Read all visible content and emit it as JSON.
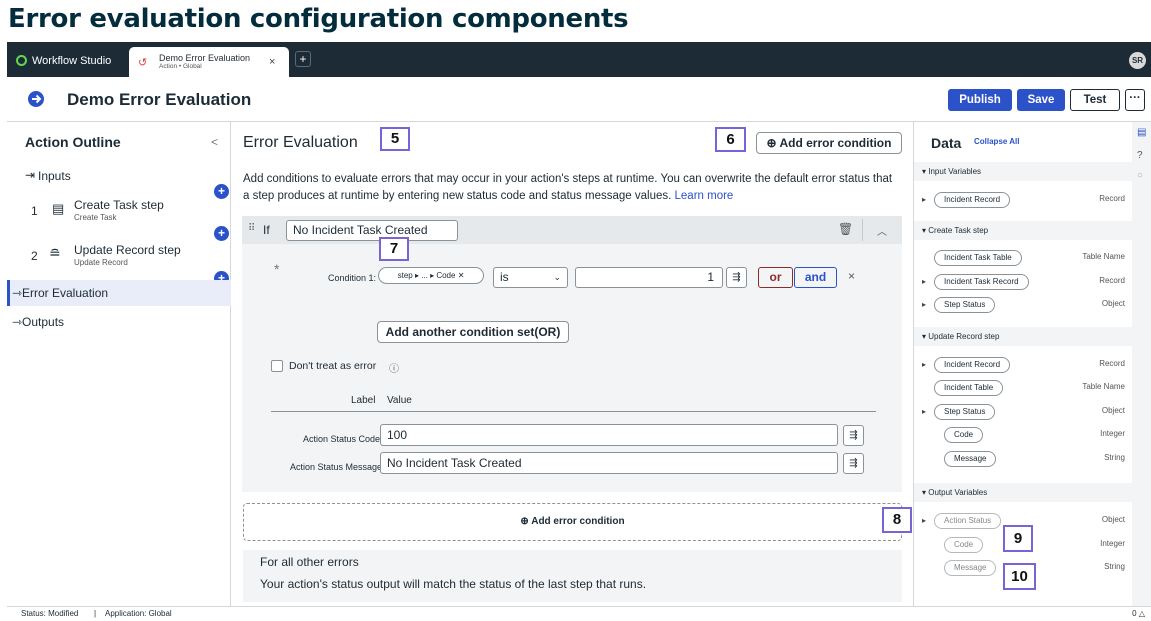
{
  "heading": "Error evaluation configuration components",
  "topbar": {
    "app_tab": "Workflow Studio",
    "doc_tab_title": "Demo Error Evaluation",
    "doc_tab_sub": "Action • Global",
    "close": "×",
    "new_tab": "+",
    "avatar": "SR"
  },
  "titlebar": {
    "title": "Demo Error Evaluation",
    "publish": "Publish",
    "save": "Save",
    "test": "Test",
    "more": "···"
  },
  "outline": {
    "title": "Action Outline",
    "collapse": "<",
    "inputs": "Inputs",
    "steps": [
      {
        "num": "1",
        "label": "Create Task step",
        "sub": "Create Task"
      },
      {
        "num": "2",
        "label": "Update Record step",
        "sub": "Update Record"
      }
    ],
    "error_eval": "Error Evaluation",
    "outputs": "Outputs",
    "plus": "+"
  },
  "main": {
    "title": "Error Evaluation",
    "add_condition_top": "Add error condition",
    "description": "Add conditions to evaluate errors that may occur in your action's steps at runtime. You can overwrite the default error status that a step produces at runtime by entering new status code and status message values.",
    "learn_more": "Learn more",
    "if_label": "If",
    "if_value": "No Incident Task Created",
    "condition_label": "Condition 1:",
    "condition_pill": "step ▸ ... ▸ Code",
    "operator": "is",
    "value": "1",
    "or": "or",
    "and": "and",
    "add_condition_set": "Add another condition set(OR)",
    "dont_treat": "Don't treat as error",
    "col_label": "Label",
    "col_value": "Value",
    "status_code_label": "Action Status Code",
    "status_code_value": "100",
    "status_msg_label": "Action Status Message",
    "status_msg_value": "No Incident Task Created",
    "add_condition_bottom": "Add error condition",
    "other_title": "For all other errors",
    "other_text": "Your action's status output will match the status of the last step that runs."
  },
  "markers": [
    "5",
    "6",
    "7",
    "8",
    "9",
    "10"
  ],
  "data_panel": {
    "title": "Data",
    "collapse_all": "Collapse All",
    "sections": {
      "input": "Input Variables",
      "create": "Create Task step",
      "update": "Update Record step",
      "output": "Output Variables"
    },
    "rows": {
      "in_incident": {
        "name": "Incident Record",
        "type": "Record"
      },
      "ct_table": {
        "name": "Incident Task Table",
        "type": "Table Name"
      },
      "ct_record": {
        "name": "Incident Task Record",
        "type": "Record"
      },
      "ct_status": {
        "name": "Step Status",
        "type": "Object"
      },
      "ur_record": {
        "name": "Incident Record",
        "type": "Record"
      },
      "ur_table": {
        "name": "Incident Table",
        "type": "Table Name"
      },
      "ur_status": {
        "name": "Step Status",
        "type": "Object"
      },
      "ur_code": {
        "name": "Code",
        "type": "Integer"
      },
      "ur_msg": {
        "name": "Message",
        "type": "String"
      },
      "out_status": {
        "name": "Action Status",
        "type": "Object"
      },
      "out_code": {
        "name": "Code",
        "type": "Integer"
      },
      "out_msg": {
        "name": "Message",
        "type": "String"
      }
    }
  },
  "statusbar": {
    "status": "Status: Modified",
    "sep": "|",
    "application": "Application: Global",
    "right": "0 △"
  }
}
